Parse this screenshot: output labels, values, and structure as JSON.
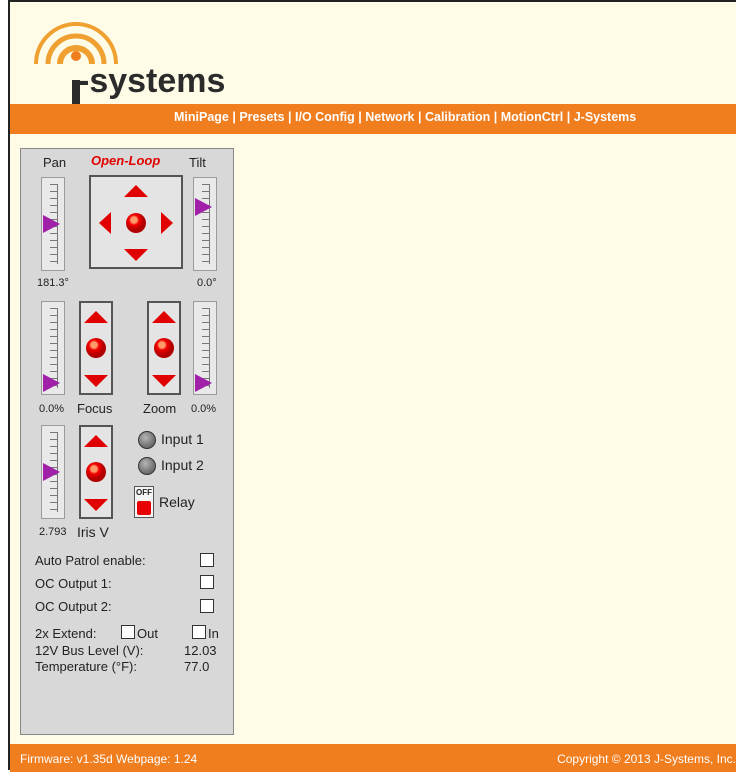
{
  "logo": {
    "text": "j-systems"
  },
  "nav": {
    "items": [
      "MiniPage",
      "Presets",
      "I/O Config",
      "Network",
      "Calibration",
      "MotionCtrl",
      "J-Systems"
    ],
    "separator": "|"
  },
  "panel": {
    "mode": "Open-Loop",
    "pan": {
      "label": "Pan",
      "value": "181.3°",
      "level": 0.5
    },
    "tilt": {
      "label": "Tilt",
      "value": "0.0°",
      "level": 0.25
    },
    "focus": {
      "label": "Focus",
      "value": "0.0%",
      "level": 1.0
    },
    "zoom": {
      "label": "Zoom",
      "value": "0.0%",
      "level": 1.0
    },
    "iris": {
      "label": "Iris V",
      "value": "2.793",
      "level": 0.5
    },
    "inputs": [
      "Input 1",
      "Input 2"
    ],
    "relay": {
      "label": "Relay",
      "state": "OFF"
    },
    "auto_patrol": "Auto Patrol enable:",
    "oc1": "OC Output 1:",
    "oc2": "OC Output 2:",
    "extend": {
      "label": "2x Extend:",
      "out": "Out",
      "in": "In"
    },
    "bus": {
      "label": "12V Bus Level (V):",
      "value": "12.03"
    },
    "temp": {
      "label": "Temperature (°F):",
      "value": "77.0"
    }
  },
  "footer": {
    "firmware": "Firmware: v1.35d  Webpage: 1.24",
    "copyright": "Copyright © 2013 J-Systems, Inc."
  },
  "colors": {
    "accent": "#f07d1e",
    "arrow": "#e00000",
    "thumb": "#a020a8",
    "mode": "#e00000"
  }
}
